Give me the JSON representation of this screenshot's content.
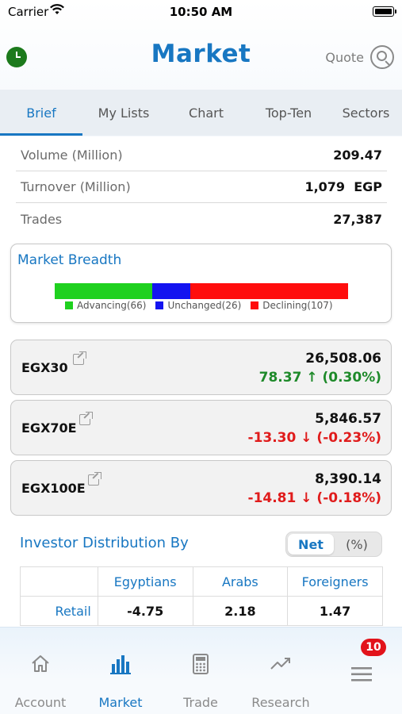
{
  "status_bar": {
    "carrier": "Carrier",
    "time": "10:50 AM"
  },
  "header": {
    "title": "Market",
    "quote_label": "Quote"
  },
  "tabs": [
    {
      "label": "Brief",
      "active": true
    },
    {
      "label": "My Lists",
      "active": false
    },
    {
      "label": "Chart",
      "active": false
    },
    {
      "label": "Top-Ten",
      "active": false
    },
    {
      "label": "Sectors",
      "active": false
    }
  ],
  "stats": [
    {
      "label": "Volume (Million)",
      "value": "209.47"
    },
    {
      "label": "Turnover (Million)",
      "value": "1,079  EGP"
    },
    {
      "label": "Trades",
      "value": "27,387"
    }
  ],
  "market_breadth": {
    "title": "Market Breadth",
    "advancing": {
      "label": "Advancing(66)",
      "count": 66,
      "color": "#1fd11f"
    },
    "unchanged": {
      "label": "Unchanged(26)",
      "count": 26,
      "color": "#1414f0"
    },
    "declining": {
      "label": "Declining(107)",
      "count": 107,
      "color": "#ff0d0d"
    }
  },
  "indices": [
    {
      "name": "EGX30",
      "value": "26,508.06",
      "change": "78.37 ↑ (0.30%)",
      "direction": "up"
    },
    {
      "name": "EGX70E",
      "value": "5,846.57",
      "change": "-13.30 ↓ (-0.23%)",
      "direction": "down"
    },
    {
      "name": "EGX100E",
      "value": "8,390.14",
      "change": "-14.81 ↓ (-0.18%)",
      "direction": "down"
    }
  ],
  "investor_distribution": {
    "title": "Investor Distribution By",
    "toggle": {
      "net": "Net",
      "percent": "(%)",
      "selected": "net"
    },
    "columns": [
      "Egyptians",
      "Arabs",
      "Foreigners"
    ],
    "rows": [
      {
        "label": "Retail",
        "values": [
          "-4.75",
          "2.18",
          "1.47"
        ]
      }
    ]
  },
  "tabbar": {
    "items": [
      {
        "label": "Account",
        "icon": "home-icon",
        "active": false
      },
      {
        "label": "Market",
        "icon": "bar-chart-icon",
        "active": true
      },
      {
        "label": "Trade",
        "icon": "calculator-icon",
        "active": false
      },
      {
        "label": "Research",
        "icon": "trend-icon",
        "active": false
      },
      {
        "label": "",
        "icon": "menu-icon",
        "active": false
      }
    ],
    "badge": "10"
  }
}
